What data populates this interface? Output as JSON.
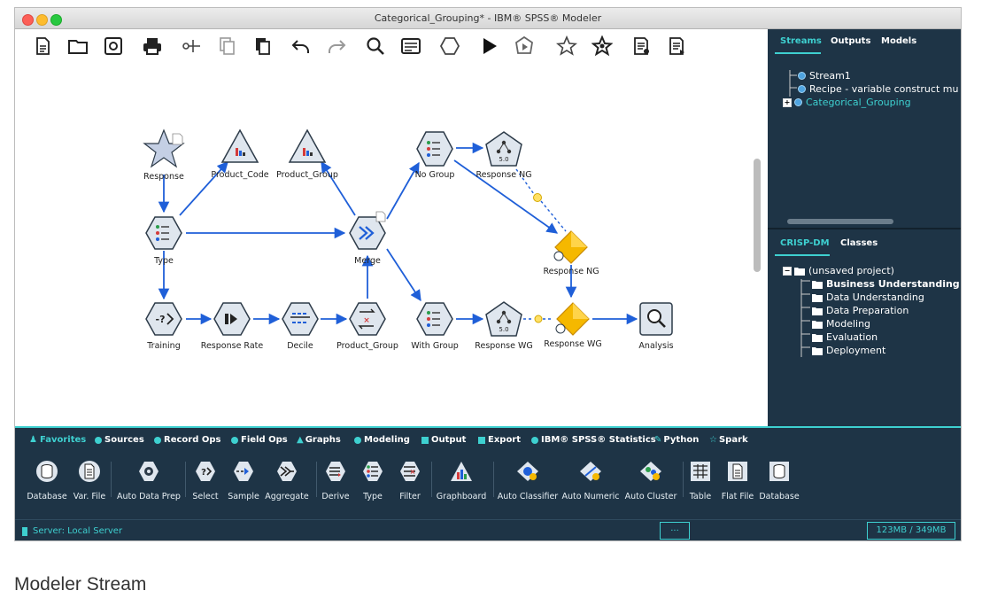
{
  "window": {
    "title": "Categorical_Grouping* - IBM® SPSS® Modeler"
  },
  "colors": {
    "accent": "#3ed0d0",
    "panel": "#1e3446",
    "link": "#1f5fd8",
    "node_fill": "#dfe6ee",
    "node_stroke": "#2d3b49",
    "model_gold": "#f5b800"
  },
  "toolbar": {
    "icons": [
      "new-stream-icon",
      "open-folder-icon",
      "save-icon",
      "print-icon",
      "cut-icon",
      "copy-icon",
      "paste-icon",
      "undo-icon",
      "redo-icon",
      "search-icon",
      "properties-icon",
      "supernode-icon",
      "run-icon",
      "run-selection-icon",
      "star-icon",
      "favorite-star-icon",
      "annotate-icon",
      "outline-icon"
    ]
  },
  "canvas": {
    "nodes": [
      {
        "id": "response",
        "label": "Response",
        "shape": "star"
      },
      {
        "id": "product_code",
        "label": "Product_Code",
        "shape": "triangle"
      },
      {
        "id": "product_group_graph",
        "label": "Product_Group",
        "shape": "triangle"
      },
      {
        "id": "no_group",
        "label": "No Group",
        "shape": "hexagon"
      },
      {
        "id": "response_ng",
        "label": "Response NG",
        "shape": "pentagon"
      },
      {
        "id": "type",
        "label": "Type",
        "shape": "hexagon"
      },
      {
        "id": "merge",
        "label": "Merge",
        "shape": "hexagon"
      },
      {
        "id": "response_ng_model",
        "label": "Response NG",
        "shape": "diamond"
      },
      {
        "id": "training",
        "label": "Training",
        "shape": "hexagon"
      },
      {
        "id": "response_rate",
        "label": "Response Rate",
        "shape": "hexagon"
      },
      {
        "id": "decile",
        "label": "Decile",
        "shape": "hexagon"
      },
      {
        "id": "product_group",
        "label": "Product_Group",
        "shape": "hexagon"
      },
      {
        "id": "with_group",
        "label": "With Group",
        "shape": "hexagon"
      },
      {
        "id": "response_wg",
        "label": "Response WG",
        "shape": "pentagon"
      },
      {
        "id": "response_wg_model",
        "label": "Response WG",
        "shape": "diamond"
      },
      {
        "id": "analysis",
        "label": "Analysis",
        "shape": "square"
      }
    ]
  },
  "streams_panel": {
    "tabs": [
      "Streams",
      "Outputs",
      "Models"
    ],
    "active_tab": "Streams",
    "items": [
      "Stream1",
      "Recipe - variable construct mu",
      "Categorical_Grouping"
    ]
  },
  "crisp_panel": {
    "tabs": [
      "CRISP-DM",
      "Classes"
    ],
    "active_tab": "CRISP-DM",
    "root": "(unsaved project)",
    "folders": [
      "Business Understanding",
      "Data Understanding",
      "Data Preparation",
      "Modeling",
      "Evaluation",
      "Deployment"
    ]
  },
  "palette": {
    "tabs": [
      "Favorites",
      "Sources",
      "Record Ops",
      "Field Ops",
      "Graphs",
      "Modeling",
      "Output",
      "Export",
      "IBM® SPSS® Statistics",
      "Python",
      "Spark"
    ],
    "active_tab": "Favorites",
    "items": [
      "Database",
      "Var. File",
      "Auto Data Prep",
      "Select",
      "Sample",
      "Aggregate",
      "Derive",
      "Type",
      "Filter",
      "Graphboard",
      "Auto Classifier",
      "Auto Numeric",
      "Auto Cluster",
      "Table",
      "Flat File",
      "Database"
    ]
  },
  "statusbar": {
    "server": "Server: Local Server",
    "middle": "...",
    "memory": "123MB / 349MB"
  },
  "caption": "Modeler Stream"
}
